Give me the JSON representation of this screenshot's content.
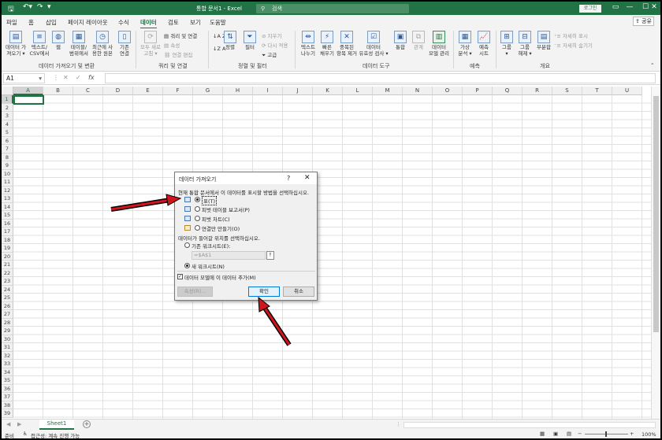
{
  "titlebar": {
    "autosave_icon": "save-icon",
    "undo_icon": "undo-icon",
    "redo_icon": "redo-icon",
    "title": "통합 문서1 - Excel",
    "search_placeholder": "검색",
    "login": "로그인",
    "brand_color": "#217346"
  },
  "menu": {
    "tabs": [
      "파일",
      "홈",
      "삽입",
      "페이지 레이아웃",
      "수식",
      "데이터",
      "검토",
      "보기",
      "도움말"
    ],
    "active": "데이터",
    "share": "공유"
  },
  "ribbon": {
    "get_data": {
      "btn1": "데이터 가\n져오기 ▾",
      "btn2": "텍스트/\nCSV에서",
      "btn3": "웹",
      "btn4": "테이블/\n범위에서",
      "btn5": "최근에 사\n용한 원본",
      "btn6": "기존\n연결",
      "group": "데이터 가져오기 및 변환"
    },
    "queries": {
      "refresh": "모두 새로\n고침 ▾",
      "q1": "쿼리 및 연결",
      "q2": "속성",
      "q3": "연결 편집",
      "group": "쿼리 및 연결"
    },
    "sort": {
      "az": "↓A Z",
      "za": "↓Z A",
      "sort": "정렬",
      "filter": "필터",
      "clear": "지우기",
      "reapply": "다시 적용",
      "advanced": "고급",
      "group": "정렬 및 필터"
    },
    "tools": {
      "t1": "텍스트\n나누기",
      "t2": "빠른\n채우기",
      "t3": "중복된\n항목 제거",
      "t4": "데이터\n유효성 검사 ▾",
      "t5": "통합",
      "t6": "관계",
      "t7": "데이터\n모델 관리",
      "group": "데이터 도구"
    },
    "forecast": {
      "f1": "가상\n분석 ▾",
      "f2": "예측\n시트",
      "group": "예측"
    },
    "outline": {
      "o1": "그룹\n▾",
      "o2": "그룹\n해제 ▾",
      "o3": "부분합",
      "show": "자세히 표시",
      "hide": "자세히 숨기기",
      "group": "개요"
    }
  },
  "formula_bar": {
    "name_box": "A1",
    "cancel": "✕",
    "enter": "✓",
    "fx": "fx",
    "value": ""
  },
  "grid": {
    "columns": [
      "A",
      "B",
      "C",
      "D",
      "E",
      "F",
      "G",
      "H",
      "I",
      "J",
      "K",
      "L",
      "M",
      "N",
      "O",
      "P",
      "Q",
      "R",
      "S",
      "T",
      "U"
    ],
    "rows": [
      "1",
      "2",
      "3",
      "4",
      "5",
      "6",
      "7",
      "8",
      "9",
      "10",
      "11",
      "12",
      "13",
      "14",
      "15",
      "16",
      "17",
      "18",
      "19",
      "20",
      "21",
      "22",
      "23",
      "24",
      "25",
      "26",
      "27",
      "28",
      "29",
      "30",
      "31",
      "32",
      "33",
      "34",
      "35",
      "36",
      "37",
      "38",
      "39"
    ],
    "selected_cell": "A1"
  },
  "dialog": {
    "title": "데이터 가져오기",
    "help": "?",
    "close": "✕",
    "prompt1": "현재 통합 문서에서 이 데이터를 표시할 방법을 선택하십시오.",
    "opt_table": "표(T)",
    "opt_pivot_table": "피벗 테이블 보고서(P)",
    "opt_pivot_chart": "피벗 차트(C)",
    "opt_connection": "연결만 만들기(O)",
    "prompt2": "데이터가 들어갈 위치를 선택하십시오.",
    "opt_existing": "기존 워크시트(E):",
    "ref_value": "=$A$1",
    "opt_new": "새 워크시트(N)",
    "datamodel": "데이터 모델에 이 데이터 추가(M)",
    "properties": "속성(R)...",
    "ok": "확인",
    "cancel": "취소"
  },
  "sheets": {
    "tab": "Sheet1",
    "add": "+"
  },
  "status": {
    "ready": "준비",
    "accessibility": "접근성: 계속 진행 가능",
    "zoom": "100%"
  }
}
